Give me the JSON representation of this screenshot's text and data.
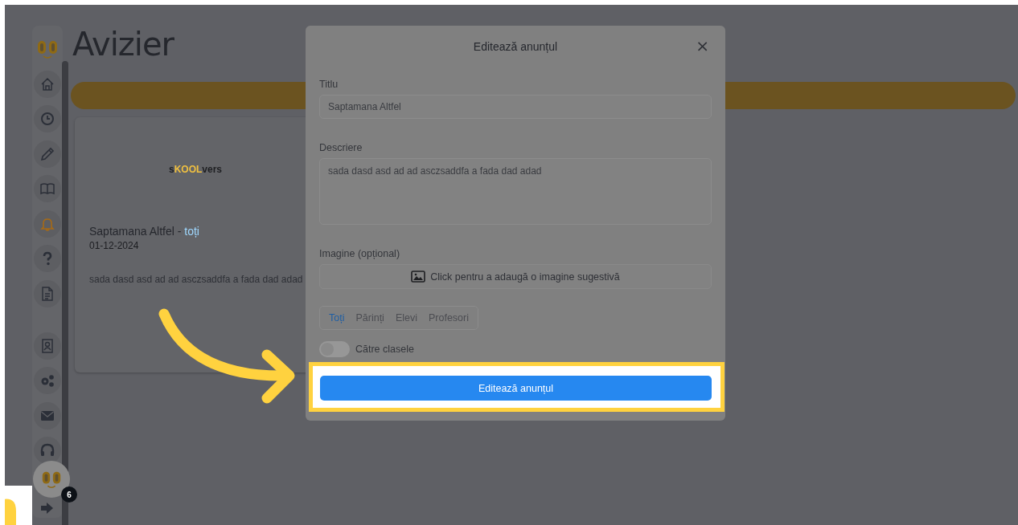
{
  "sidebar": {
    "items": [
      {
        "selected": false
      },
      {
        "selected": false
      },
      {
        "selected": false
      },
      {
        "selected": false
      },
      {
        "selected": true
      },
      {
        "selected": false
      },
      {
        "selected": false
      },
      {
        "selected": false
      },
      {
        "selected": false
      },
      {
        "selected": false
      },
      {
        "selected": false
      },
      {
        "selected": false
      }
    ]
  },
  "page": {
    "title": "Avizier"
  },
  "notice": {
    "logo": {
      "start": "s",
      "accent": "KOOL",
      "end": "vers"
    },
    "title": "Saptamana Altfel",
    "separator": " - ",
    "audience": "toți",
    "date": "01-12-2024",
    "body": "sada dasd asd ad ad asczsaddfa a fada dad adad"
  },
  "modal": {
    "title": "Editează anunțul",
    "close": "×",
    "fields": [
      {
        "kind": "input",
        "label": "Titlu",
        "value": "Saptamana Altfel"
      },
      {
        "kind": "textarea",
        "label": "Descriere",
        "value": "sada dasd asd ad ad asczsaddfa a fada dad adad"
      },
      {
        "kind": "image",
        "label": "Imagine (opțional)",
        "value": "Click pentru a adaugă o imagine sugestivă"
      }
    ],
    "tabs": [
      {
        "label": "Toți",
        "selected": true
      },
      {
        "label": "Părinți",
        "selected": false
      },
      {
        "label": "Elevi",
        "selected": false
      },
      {
        "label": "Profesori",
        "selected": false
      }
    ],
    "toggle": {
      "label": "Către clasele",
      "on": false
    },
    "submit": "Editează anunțul"
  },
  "avatar": {
    "badge": "6"
  }
}
